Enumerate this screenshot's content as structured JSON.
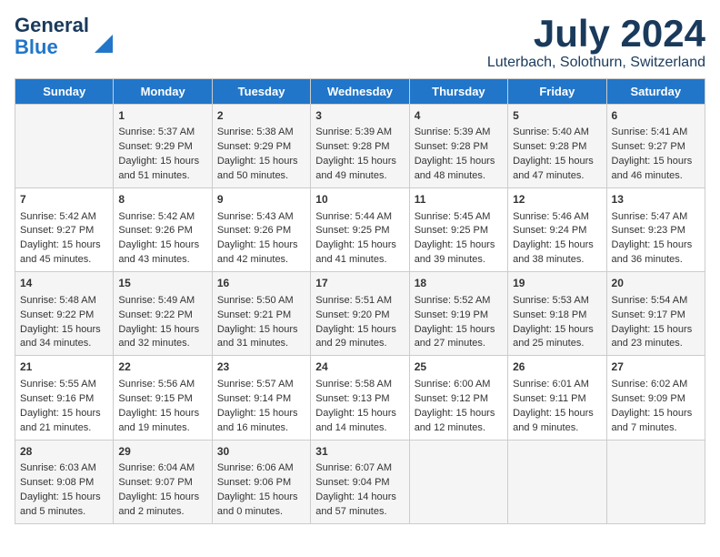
{
  "logo": {
    "line1": "General",
    "line2": "Blue"
  },
  "title": "July 2024",
  "location": "Luterbach, Solothurn, Switzerland",
  "days_of_week": [
    "Sunday",
    "Monday",
    "Tuesday",
    "Wednesday",
    "Thursday",
    "Friday",
    "Saturday"
  ],
  "weeks": [
    [
      {
        "day": "",
        "content": ""
      },
      {
        "day": "1",
        "content": "Sunrise: 5:37 AM\nSunset: 9:29 PM\nDaylight: 15 hours\nand 51 minutes."
      },
      {
        "day": "2",
        "content": "Sunrise: 5:38 AM\nSunset: 9:29 PM\nDaylight: 15 hours\nand 50 minutes."
      },
      {
        "day": "3",
        "content": "Sunrise: 5:39 AM\nSunset: 9:28 PM\nDaylight: 15 hours\nand 49 minutes."
      },
      {
        "day": "4",
        "content": "Sunrise: 5:39 AM\nSunset: 9:28 PM\nDaylight: 15 hours\nand 48 minutes."
      },
      {
        "day": "5",
        "content": "Sunrise: 5:40 AM\nSunset: 9:28 PM\nDaylight: 15 hours\nand 47 minutes."
      },
      {
        "day": "6",
        "content": "Sunrise: 5:41 AM\nSunset: 9:27 PM\nDaylight: 15 hours\nand 46 minutes."
      }
    ],
    [
      {
        "day": "7",
        "content": "Sunrise: 5:42 AM\nSunset: 9:27 PM\nDaylight: 15 hours\nand 45 minutes."
      },
      {
        "day": "8",
        "content": "Sunrise: 5:42 AM\nSunset: 9:26 PM\nDaylight: 15 hours\nand 43 minutes."
      },
      {
        "day": "9",
        "content": "Sunrise: 5:43 AM\nSunset: 9:26 PM\nDaylight: 15 hours\nand 42 minutes."
      },
      {
        "day": "10",
        "content": "Sunrise: 5:44 AM\nSunset: 9:25 PM\nDaylight: 15 hours\nand 41 minutes."
      },
      {
        "day": "11",
        "content": "Sunrise: 5:45 AM\nSunset: 9:25 PM\nDaylight: 15 hours\nand 39 minutes."
      },
      {
        "day": "12",
        "content": "Sunrise: 5:46 AM\nSunset: 9:24 PM\nDaylight: 15 hours\nand 38 minutes."
      },
      {
        "day": "13",
        "content": "Sunrise: 5:47 AM\nSunset: 9:23 PM\nDaylight: 15 hours\nand 36 minutes."
      }
    ],
    [
      {
        "day": "14",
        "content": "Sunrise: 5:48 AM\nSunset: 9:22 PM\nDaylight: 15 hours\nand 34 minutes."
      },
      {
        "day": "15",
        "content": "Sunrise: 5:49 AM\nSunset: 9:22 PM\nDaylight: 15 hours\nand 32 minutes."
      },
      {
        "day": "16",
        "content": "Sunrise: 5:50 AM\nSunset: 9:21 PM\nDaylight: 15 hours\nand 31 minutes."
      },
      {
        "day": "17",
        "content": "Sunrise: 5:51 AM\nSunset: 9:20 PM\nDaylight: 15 hours\nand 29 minutes."
      },
      {
        "day": "18",
        "content": "Sunrise: 5:52 AM\nSunset: 9:19 PM\nDaylight: 15 hours\nand 27 minutes."
      },
      {
        "day": "19",
        "content": "Sunrise: 5:53 AM\nSunset: 9:18 PM\nDaylight: 15 hours\nand 25 minutes."
      },
      {
        "day": "20",
        "content": "Sunrise: 5:54 AM\nSunset: 9:17 PM\nDaylight: 15 hours\nand 23 minutes."
      }
    ],
    [
      {
        "day": "21",
        "content": "Sunrise: 5:55 AM\nSunset: 9:16 PM\nDaylight: 15 hours\nand 21 minutes."
      },
      {
        "day": "22",
        "content": "Sunrise: 5:56 AM\nSunset: 9:15 PM\nDaylight: 15 hours\nand 19 minutes."
      },
      {
        "day": "23",
        "content": "Sunrise: 5:57 AM\nSunset: 9:14 PM\nDaylight: 15 hours\nand 16 minutes."
      },
      {
        "day": "24",
        "content": "Sunrise: 5:58 AM\nSunset: 9:13 PM\nDaylight: 15 hours\nand 14 minutes."
      },
      {
        "day": "25",
        "content": "Sunrise: 6:00 AM\nSunset: 9:12 PM\nDaylight: 15 hours\nand 12 minutes."
      },
      {
        "day": "26",
        "content": "Sunrise: 6:01 AM\nSunset: 9:11 PM\nDaylight: 15 hours\nand 9 minutes."
      },
      {
        "day": "27",
        "content": "Sunrise: 6:02 AM\nSunset: 9:09 PM\nDaylight: 15 hours\nand 7 minutes."
      }
    ],
    [
      {
        "day": "28",
        "content": "Sunrise: 6:03 AM\nSunset: 9:08 PM\nDaylight: 15 hours\nand 5 minutes."
      },
      {
        "day": "29",
        "content": "Sunrise: 6:04 AM\nSunset: 9:07 PM\nDaylight: 15 hours\nand 2 minutes."
      },
      {
        "day": "30",
        "content": "Sunrise: 6:06 AM\nSunset: 9:06 PM\nDaylight: 15 hours\nand 0 minutes."
      },
      {
        "day": "31",
        "content": "Sunrise: 6:07 AM\nSunset: 9:04 PM\nDaylight: 14 hours\nand 57 minutes."
      },
      {
        "day": "",
        "content": ""
      },
      {
        "day": "",
        "content": ""
      },
      {
        "day": "",
        "content": ""
      }
    ]
  ]
}
